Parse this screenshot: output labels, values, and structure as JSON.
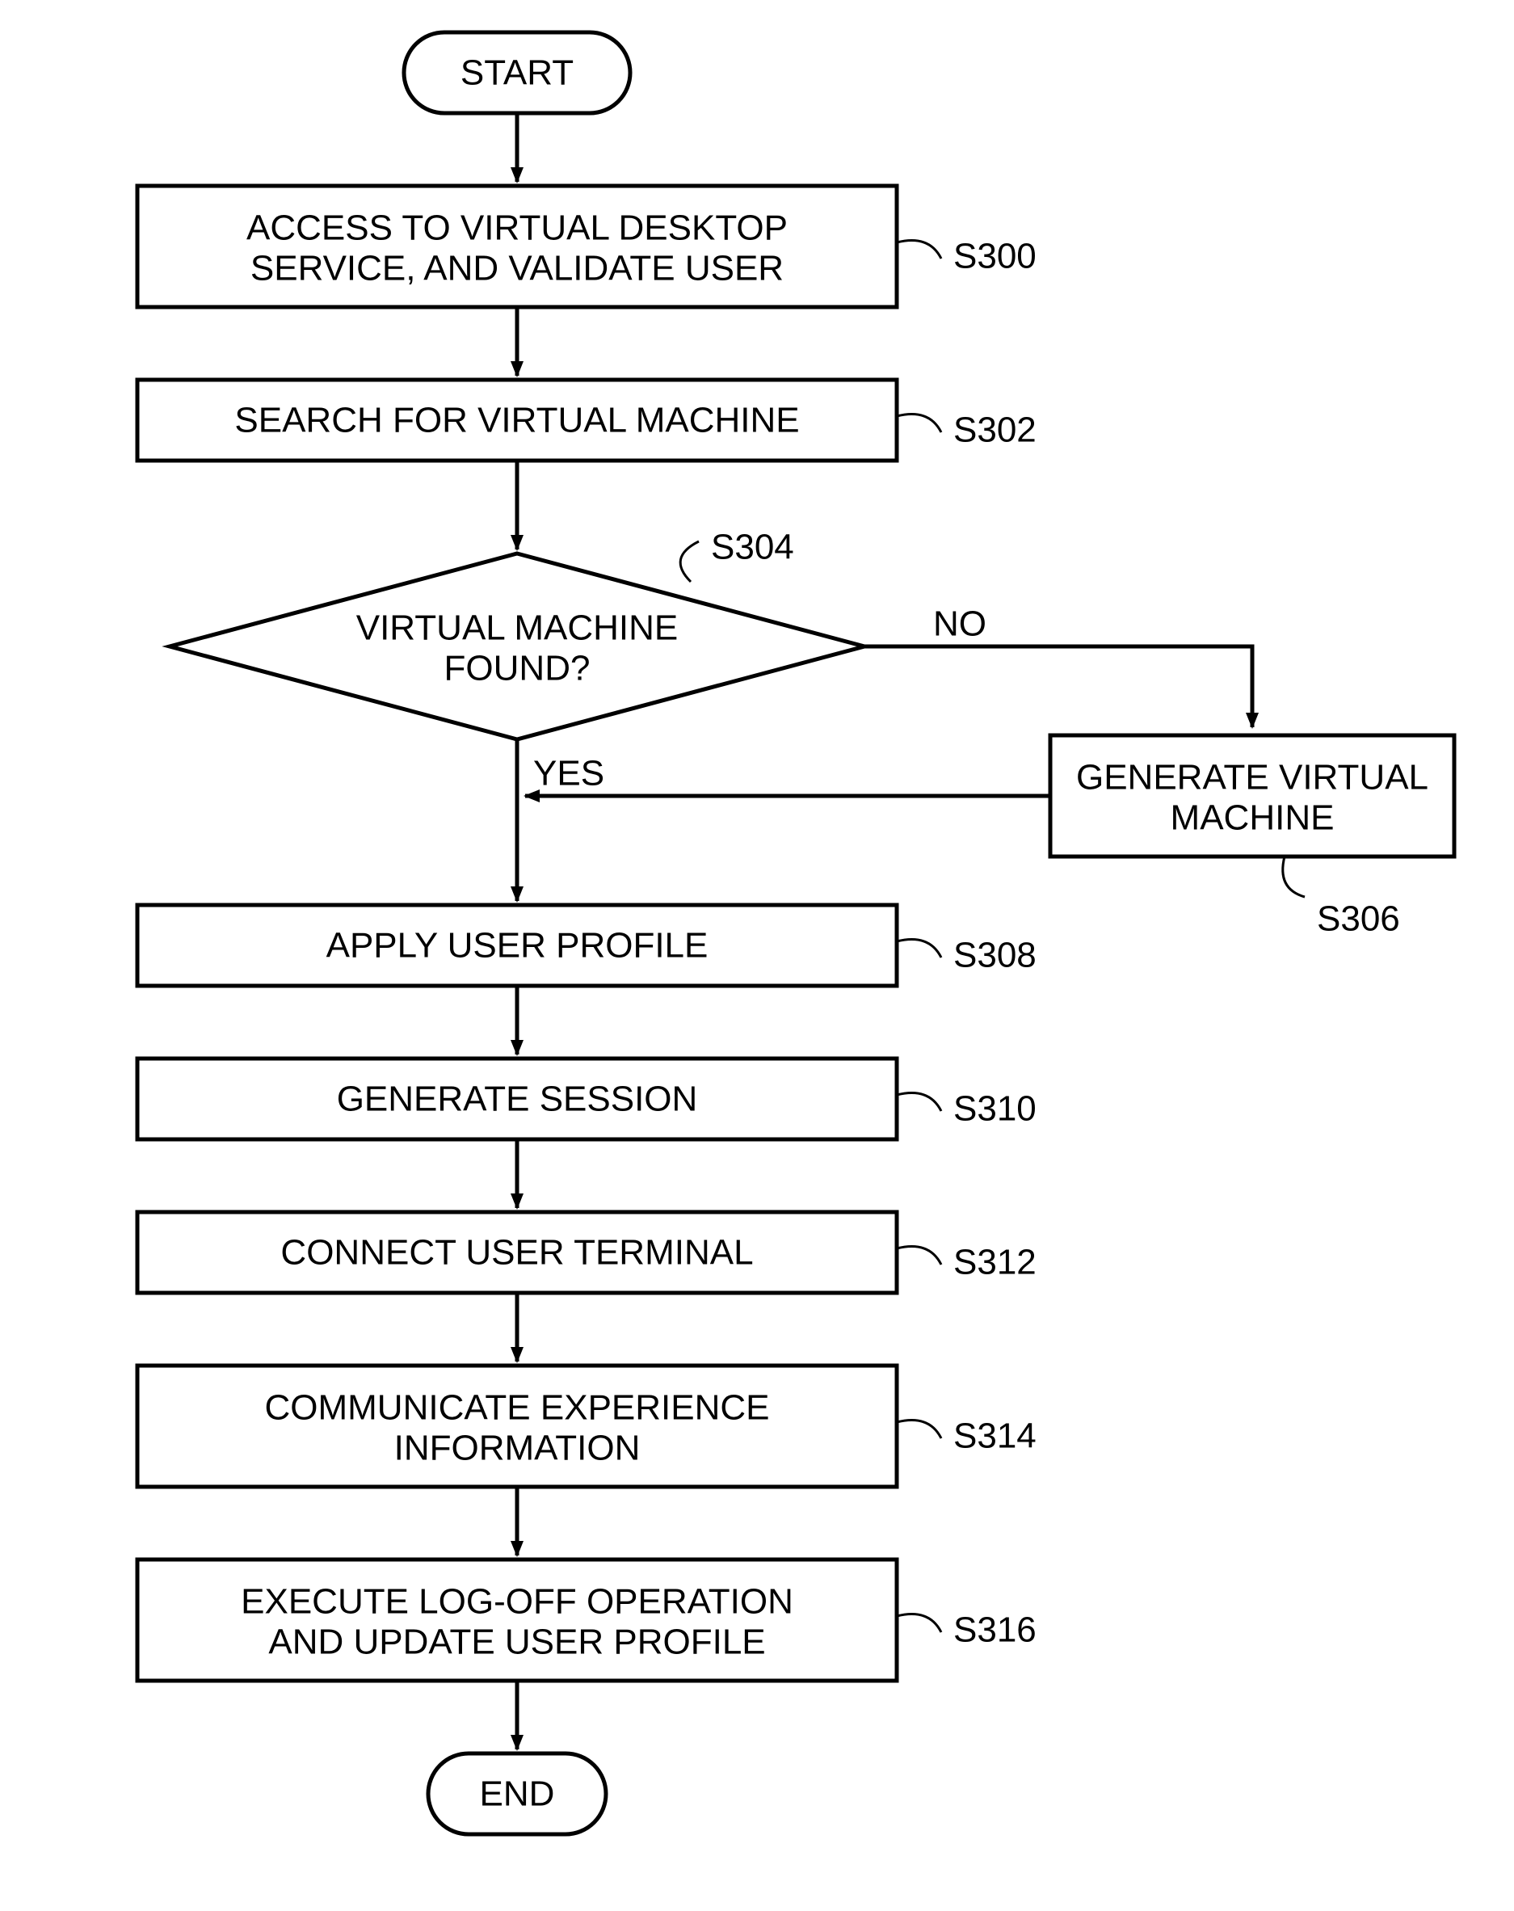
{
  "terminator": {
    "start": "START",
    "end": "END"
  },
  "steps": {
    "s300": {
      "line1": "ACCESS TO VIRTUAL DESKTOP",
      "line2": "SERVICE, AND VALIDATE USER",
      "label": "S300"
    },
    "s302": {
      "line1": "SEARCH FOR VIRTUAL MACHINE",
      "label": "S302"
    },
    "s304": {
      "line1": "VIRTUAL MACHINE",
      "line2": "FOUND?",
      "label": "S304",
      "yes": "YES",
      "no": "NO"
    },
    "s306": {
      "line1": "GENERATE VIRTUAL",
      "line2": "MACHINE",
      "label": "S306"
    },
    "s308": {
      "line1": "APPLY USER PROFILE",
      "label": "S308"
    },
    "s310": {
      "line1": "GENERATE SESSION",
      "label": "S310"
    },
    "s312": {
      "line1": "CONNECT USER TERMINAL",
      "label": "S312"
    },
    "s314": {
      "line1": "COMMUNICATE EXPERIENCE",
      "line2": "INFORMATION",
      "label": "S314"
    },
    "s316": {
      "line1": "EXECUTE LOG-OFF OPERATION",
      "line2": "AND UPDATE USER PROFILE",
      "label": "S316"
    }
  }
}
